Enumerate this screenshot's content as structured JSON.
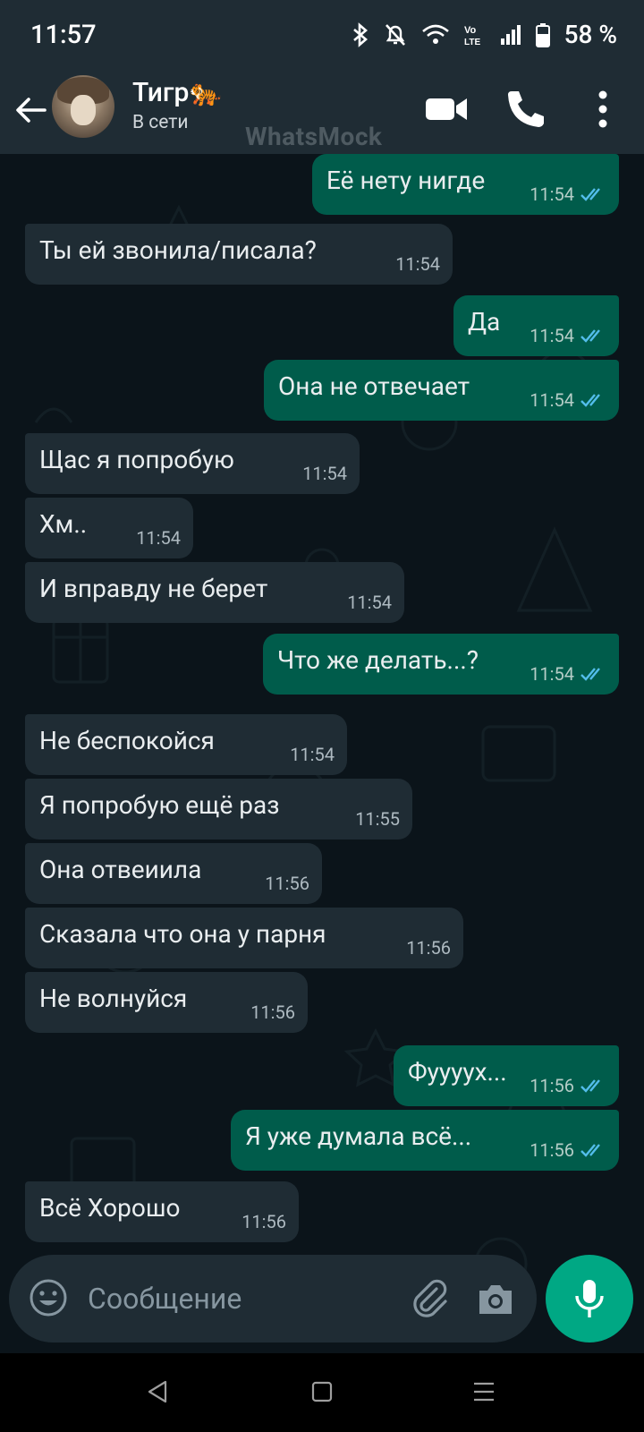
{
  "status_bar": {
    "time": "11:57",
    "battery": "58 %"
  },
  "header": {
    "contact_name": "Тигр🐅",
    "contact_status": "В сети",
    "watermark": "WhatsMock"
  },
  "messages": [
    {
      "dir": "out",
      "text": "Её нету нигде",
      "time": "11:54"
    },
    {
      "dir": "in",
      "text": "Ты ей звонила/писала?",
      "time": "11:54"
    },
    {
      "dir": "out",
      "text": "Да",
      "time": "11:54"
    },
    {
      "dir": "out",
      "text": "Она не отвечает",
      "time": "11:54"
    },
    {
      "dir": "in",
      "text": "Щас я попробую",
      "time": "11:54"
    },
    {
      "dir": "in",
      "text": "Хм..",
      "time": "11:54"
    },
    {
      "dir": "in",
      "text": "И вправду не берет",
      "time": "11:54"
    },
    {
      "dir": "out",
      "text": "Что же делать...?",
      "time": "11:54"
    },
    {
      "dir": "in",
      "text": "Не беспокойся",
      "time": "11:54"
    },
    {
      "dir": "in",
      "text": "Я попробую ещё раз",
      "time": "11:55"
    },
    {
      "dir": "in",
      "text": "Она отвеиила",
      "time": "11:56"
    },
    {
      "dir": "in",
      "text": "Сказала что она у парня",
      "time": "11:56"
    },
    {
      "dir": "in",
      "text": "Не волнуйся",
      "time": "11:56"
    },
    {
      "dir": "out",
      "text": "Фуууух...",
      "time": "11:56"
    },
    {
      "dir": "out",
      "text": "Я уже думала всё...",
      "time": "11:56"
    },
    {
      "dir": "in",
      "text": "Всё Хорошо",
      "time": "11:56"
    }
  ],
  "composer": {
    "placeholder": "Сообщение"
  },
  "colors": {
    "header": "#1f2c34",
    "chat_bg": "#0b141a",
    "bubble_in": "#1f2c34",
    "bubble_out": "#005c4b",
    "accent": "#00a884",
    "read_ticks": "#53bdeb"
  },
  "icons": {
    "status": [
      "bluetooth-icon",
      "mute-icon",
      "wifi-icon",
      "volte-icon",
      "signal-icon",
      "battery-icon"
    ],
    "header": [
      "back-arrow-icon",
      "video-call-icon",
      "phone-call-icon",
      "more-vert-icon"
    ],
    "composer": [
      "emoji-icon",
      "attach-icon",
      "camera-icon",
      "mic-icon"
    ],
    "nav": [
      "nav-back-icon",
      "nav-home-icon",
      "nav-recents-icon"
    ]
  }
}
